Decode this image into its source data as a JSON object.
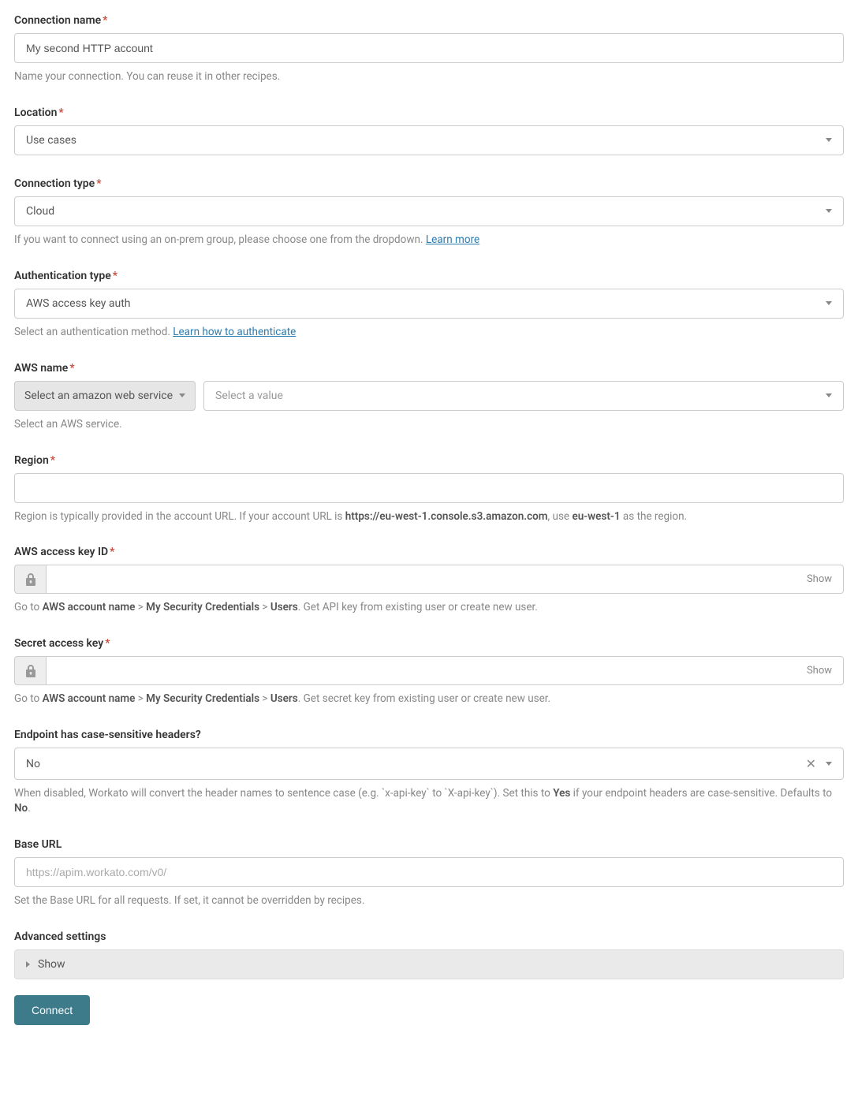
{
  "connectionName": {
    "label": "Connection name",
    "value": "My second HTTP account",
    "help": "Name your connection. You can reuse it in other recipes."
  },
  "location": {
    "label": "Location",
    "value": "Use cases"
  },
  "connectionType": {
    "label": "Connection type",
    "value": "Cloud",
    "help_prefix": "If you want to connect using an on-prem group, please choose one from the dropdown. ",
    "learnMore": "Learn more"
  },
  "authType": {
    "label": "Authentication type",
    "value": "AWS access key auth",
    "help_prefix": "Select an authentication method. ",
    "learnLink": "Learn how to authenticate"
  },
  "awsName": {
    "label": "AWS name",
    "serviceBtn": "Select an amazon web service",
    "placeholder": "Select a value",
    "help": "Select an AWS service."
  },
  "region": {
    "label": "Region",
    "help_p1": "Region is typically provided in the account URL. If your account URL is ",
    "help_url": "https://eu-west-1.console.s3.amazon.com",
    "help_p2": ", use ",
    "help_region": "eu-west-1",
    "help_p3": " as the region."
  },
  "accessKeyId": {
    "label": "AWS access key ID",
    "show": "Show",
    "help_p1": "Go to ",
    "help_b1": "AWS account name",
    "help_s1": " > ",
    "help_b2": "My Security Credentials",
    "help_s2": " > ",
    "help_b3": "Users",
    "help_p2": ". Get API key from existing user or create new user."
  },
  "secretKey": {
    "label": "Secret access key",
    "show": "Show",
    "help_p1": "Go to ",
    "help_b1": "AWS account name",
    "help_s1": " > ",
    "help_b2": "My Security Credentials",
    "help_s2": " > ",
    "help_b3": "Users",
    "help_p2": ". Get secret key from existing user or create new user."
  },
  "caseSensitive": {
    "label": "Endpoint has case-sensitive headers?",
    "value": "No",
    "help_p1": "When disabled, Workato will convert the header names to sentence case (e.g. `x-api-key` to `X-api-key`). Set this to ",
    "help_yes": "Yes",
    "help_p2": " if your endpoint headers are case-sensitive. Defaults to ",
    "help_no": "No",
    "help_p3": "."
  },
  "baseUrl": {
    "label": "Base URL",
    "placeholder": "https://apim.workato.com/v0/",
    "help": "Set the Base URL for all requests. If set, it cannot be overridden by recipes."
  },
  "advanced": {
    "label": "Advanced settings",
    "show": "Show"
  },
  "connectBtn": "Connect"
}
